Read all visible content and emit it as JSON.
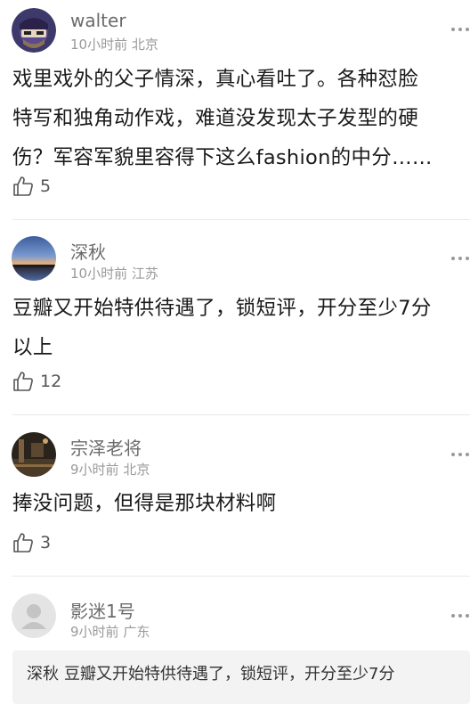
{
  "comments": [
    {
      "username": "walter",
      "time": "10小时前",
      "location": "北京",
      "lines": [
        "戏里戏外的父子情深，真心看吐了。各种怼脸",
        "特写和独角动作戏，难道没发现太子发型的硬",
        "伤？军容军貌里容得下这么fashion的中分……"
      ],
      "likes": "5",
      "avatar": "cartoon-character-avatar"
    },
    {
      "username": "深秋",
      "time": "10小时前",
      "location": "江苏",
      "lines": [
        "豆瓣又开始特供待遇了，锁短评，开分至少7分",
        "以上"
      ],
      "likes": "12",
      "avatar": "sunset-landscape-avatar"
    },
    {
      "username": "宗泽老将",
      "time": "9小时前",
      "location": "北京",
      "lines": [
        "捧没问题，但得是那块材料啊"
      ],
      "likes": "3",
      "avatar": "dark-room-avatar"
    },
    {
      "username": "影迷1号",
      "time": "9小时前",
      "location": "广东",
      "lines": [],
      "likes": "",
      "avatar": "default-user-avatar"
    }
  ],
  "reply": {
    "user": "深秋",
    "text": "豆瓣又开始特供待遇了，锁短评，开分至少7分"
  },
  "icons": {
    "like": "thumbs-up-icon",
    "more": "more-dots-icon"
  },
  "colors": {
    "username": "#6b6b6b",
    "meta": "#9a9a9a",
    "body": "#1a1a1a",
    "divider": "#e8e8e8",
    "reply_bg": "#f3f3f3"
  }
}
